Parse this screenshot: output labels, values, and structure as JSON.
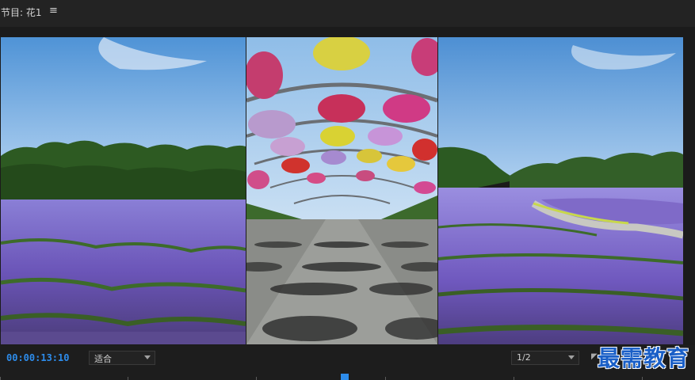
{
  "panel": {
    "title": "节目: 花1",
    "menu_icon": "hamburger-menu-icon"
  },
  "controls": {
    "timecode": "00:00:13:10",
    "fit_value": "适合",
    "resolution_value": "1/2",
    "timecode_color": "#2d8ceb"
  },
  "watermark": {
    "text": "最需教育"
  },
  "colors": {
    "accent": "#2d8ceb",
    "panel_bg": "#1d1d1d"
  }
}
